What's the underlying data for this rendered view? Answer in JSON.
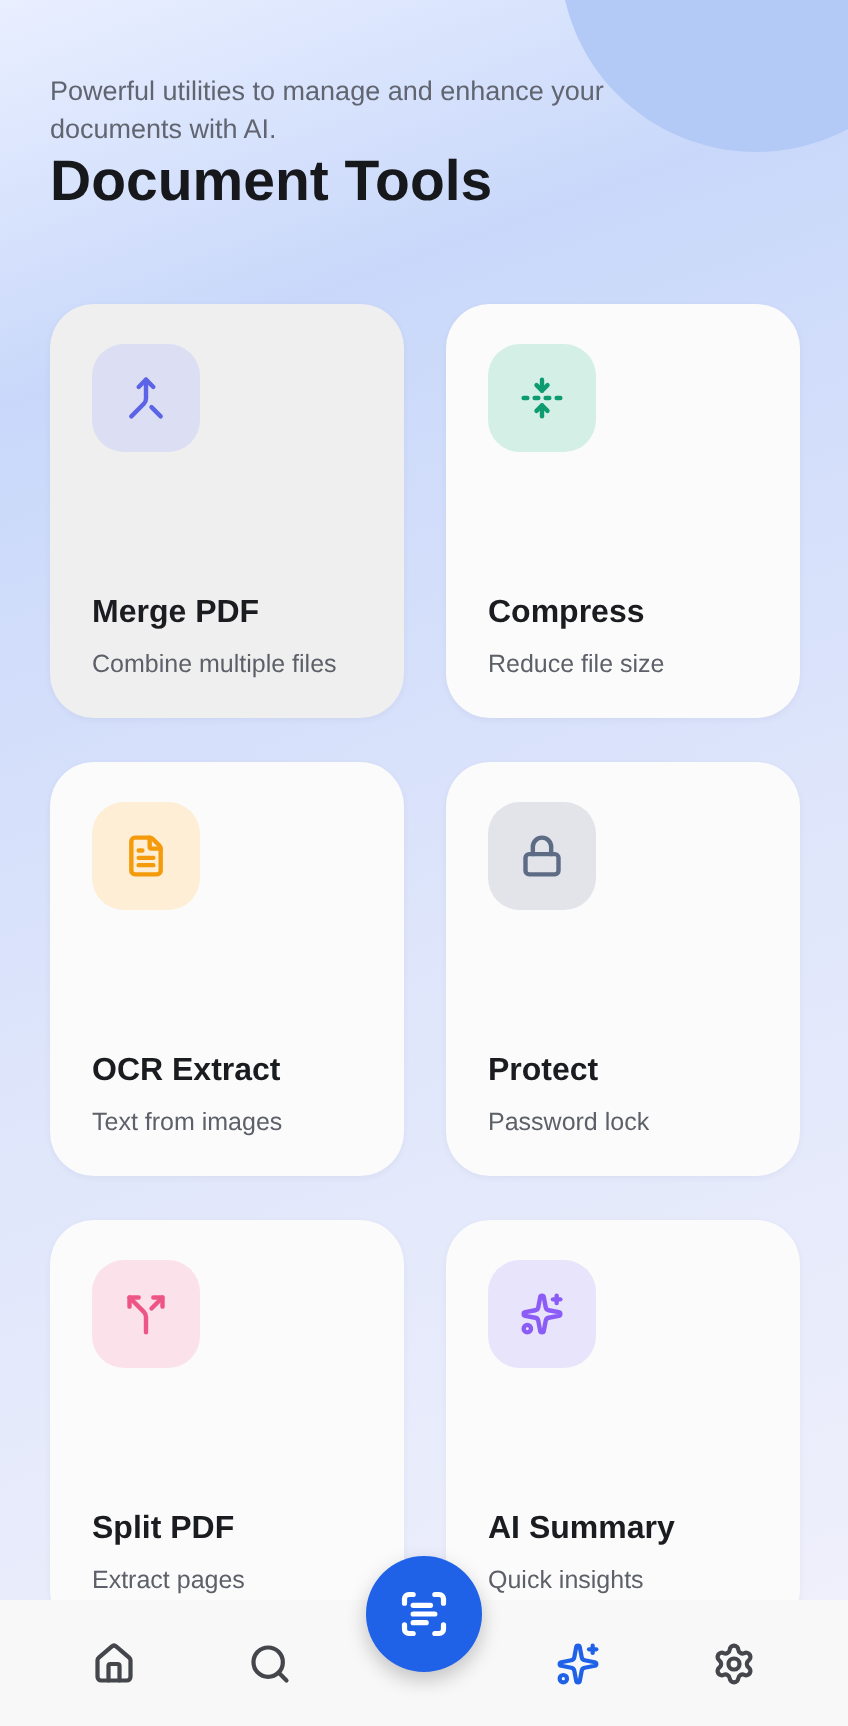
{
  "header": {
    "subtitle": "Powerful utilities to manage and enhance your documents with AI.",
    "title": "Document Tools"
  },
  "tools": [
    {
      "kind": "merge",
      "title": "Merge PDF",
      "subtitle": "Combine multiple files",
      "selected": true
    },
    {
      "kind": "compress",
      "title": "Compress",
      "subtitle": "Reduce file size",
      "selected": false
    },
    {
      "kind": "ocr",
      "title": "OCR Extract",
      "subtitle": "Text from images",
      "selected": false
    },
    {
      "kind": "protect",
      "title": "Protect",
      "subtitle": "Password lock",
      "selected": false
    },
    {
      "kind": "split",
      "title": "Split PDF",
      "subtitle": "Extract pages",
      "selected": false
    },
    {
      "kind": "ai",
      "title": "AI Summary",
      "subtitle": "Quick insights",
      "selected": false
    }
  ],
  "nav": [
    {
      "kind": "home",
      "selected": false
    },
    {
      "kind": "search",
      "selected": false
    },
    {
      "kind": "scan",
      "selected": false
    },
    {
      "kind": "ai",
      "selected": true
    },
    {
      "kind": "settings",
      "selected": false
    }
  ]
}
